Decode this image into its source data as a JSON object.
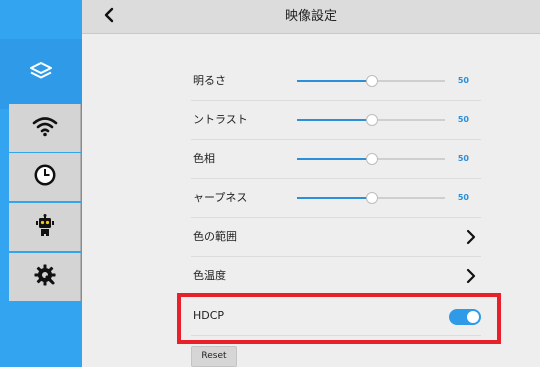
{
  "header": {
    "title": "映像設定",
    "back_icon": "chevron-left-icon"
  },
  "sidebar": {
    "items": [
      {
        "icon": "layers-icon",
        "active": true
      },
      {
        "icon": "wifi-icon",
        "active": false
      },
      {
        "icon": "clock-icon",
        "active": false
      },
      {
        "icon": "robot-icon",
        "active": false
      },
      {
        "icon": "gear-wrench-icon",
        "active": false
      }
    ]
  },
  "settings": {
    "sliders": [
      {
        "label": "明るさ",
        "value": "50",
        "level": 0.5
      },
      {
        "label": "ントラスト",
        "value": "50",
        "level": 0.5
      },
      {
        "label": "色相",
        "value": "50",
        "level": 0.5
      },
      {
        "label": "ャープネス",
        "value": "50",
        "level": 0.5
      }
    ],
    "links": [
      {
        "label": "色の範囲"
      },
      {
        "label": "色温度"
      }
    ],
    "hdcp": {
      "label": "HDCP",
      "enabled": true
    }
  },
  "reset_label": "Reset",
  "colors": {
    "accent": "#2f9be8",
    "sidebar": "#33a4f0",
    "highlight": "#e8202a"
  }
}
